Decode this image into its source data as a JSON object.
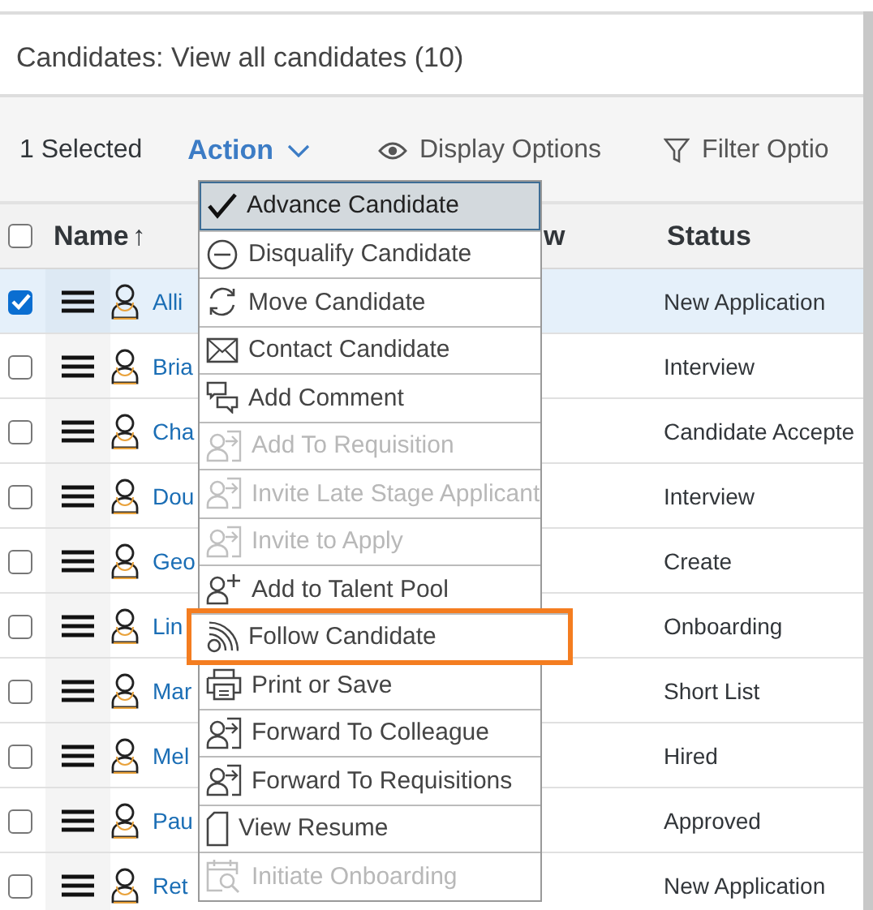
{
  "header": {
    "title": "Candidates: View all candidates (10)"
  },
  "toolbar": {
    "selection": "1 Selected",
    "action": "Action",
    "display_options": "Display Options",
    "filter_options": "Filter Optio"
  },
  "table": {
    "select_all_checked": false,
    "columns": [
      {
        "label": "Name",
        "sort_icon": "↑"
      },
      {
        "label": "w"
      },
      {
        "label": "Status"
      }
    ],
    "rows": [
      {
        "selected": true,
        "checked": true,
        "name": "Alli",
        "status": "New Application"
      },
      {
        "selected": false,
        "checked": false,
        "name": "Bria",
        "status": "Interview"
      },
      {
        "selected": false,
        "checked": false,
        "name": "Cha",
        "status": "Candidate Accepte"
      },
      {
        "selected": false,
        "checked": false,
        "name": "Dou",
        "status": "Interview"
      },
      {
        "selected": false,
        "checked": false,
        "name": "Geo",
        "status": "Create"
      },
      {
        "selected": false,
        "checked": false,
        "name": "Lin",
        "status": "Onboarding"
      },
      {
        "selected": false,
        "checked": false,
        "name": "Mar",
        "status": "Short List"
      },
      {
        "selected": false,
        "checked": false,
        "name": "Mel",
        "status": "Hired"
      },
      {
        "selected": false,
        "checked": false,
        "name": "Pau",
        "status": "Approved"
      },
      {
        "selected": false,
        "checked": false,
        "name": "Ret",
        "status": "New Application"
      }
    ]
  },
  "action_menu": {
    "items": [
      {
        "label": "Advance Candidate",
        "selected": true,
        "disabled": false,
        "highlighted": false
      },
      {
        "label": "Disqualify Candidate",
        "selected": false,
        "disabled": false,
        "highlighted": false
      },
      {
        "label": "Move Candidate",
        "selected": false,
        "disabled": false,
        "highlighted": false
      },
      {
        "label": "Contact Candidate",
        "selected": false,
        "disabled": false,
        "highlighted": false
      },
      {
        "label": "Add Comment",
        "selected": false,
        "disabled": false,
        "highlighted": false
      },
      {
        "label": "Add To Requisition",
        "selected": false,
        "disabled": true,
        "highlighted": false
      },
      {
        "label": "Invite Late Stage Applicant",
        "selected": false,
        "disabled": true,
        "highlighted": false
      },
      {
        "label": "Invite to Apply",
        "selected": false,
        "disabled": true,
        "highlighted": false
      },
      {
        "label": "Add to Talent Pool",
        "selected": false,
        "disabled": false,
        "highlighted": false
      },
      {
        "label": "Follow Candidate",
        "selected": false,
        "disabled": false,
        "highlighted": true
      },
      {
        "label": "Print or Save",
        "selected": false,
        "disabled": false,
        "highlighted": false
      },
      {
        "label": "Forward To Colleague",
        "selected": false,
        "disabled": false,
        "highlighted": false
      },
      {
        "label": "Forward To Requisitions",
        "selected": false,
        "disabled": false,
        "highlighted": false
      },
      {
        "label": "View Resume",
        "selected": false,
        "disabled": false,
        "highlighted": false
      },
      {
        "label": "Initiate Onboarding",
        "selected": false,
        "disabled": true,
        "highlighted": false
      }
    ]
  }
}
